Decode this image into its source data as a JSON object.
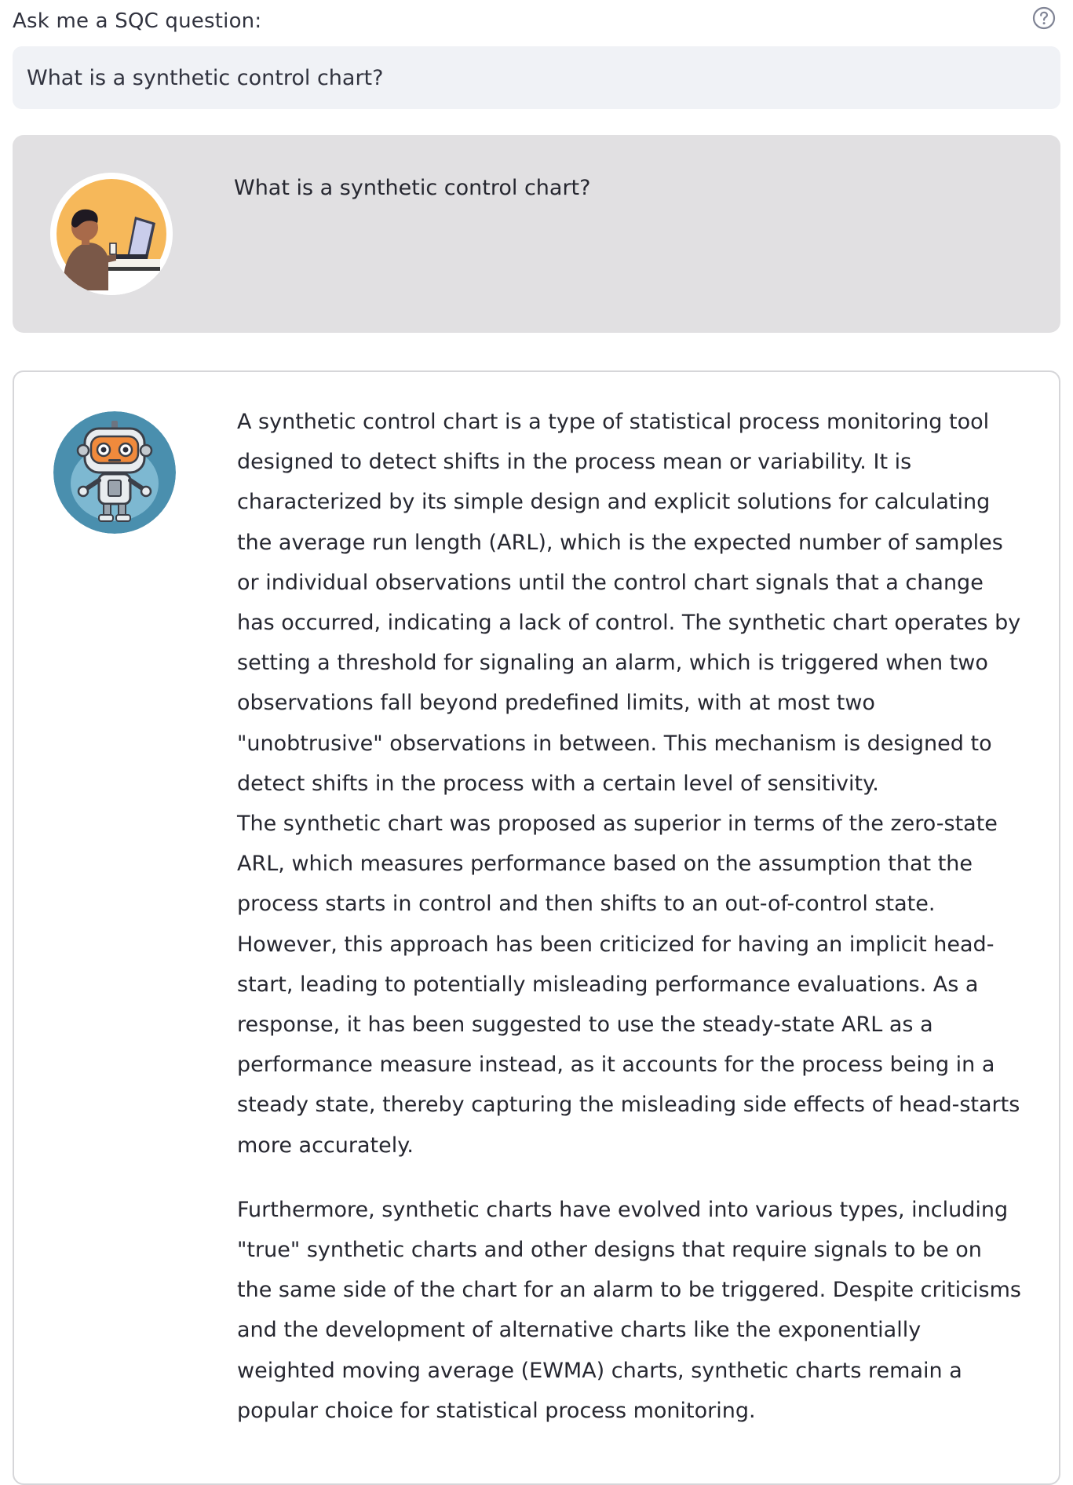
{
  "input": {
    "label": "Ask me a SQC question:",
    "value": "What is a synthetic control chart?",
    "help_icon": "help-circle-icon"
  },
  "user_message": {
    "avatar": "user-at-laptop-avatar",
    "text": "What is a synthetic control chart?"
  },
  "assistant_message": {
    "avatar": "robot-avatar",
    "paragraphs": [
      "A synthetic control chart is a type of statistical process monitoring tool designed to detect shifts in the process mean or variability. It is characterized by its simple design and explicit solutions for calculating the average run length (ARL), which is the expected number of samples or individual observations until the control chart signals that a change has occurred, indicating a lack of control. The synthetic chart operates by setting a threshold for signaling an alarm, which is triggered when two observations fall beyond predefined limits, with at most two \"unobtrusive\" observations in between. This mechanism is designed to detect shifts in the process with a certain level of sensitivity.",
      "The synthetic chart was proposed as superior in terms of the zero-state ARL, which measures performance based on the assumption that the process starts in control and then shifts to an out-of-control state. However, this approach has been criticized for having an implicit head-start, leading to potentially misleading performance evaluations. As a response, it has been suggested to use the steady-state ARL as a performance measure instead, as it accounts for the process being in a steady state, thereby capturing the misleading side effects of head-starts more accurately.",
      "Furthermore, synthetic charts have evolved into various types, including \"true\" synthetic charts and other designs that require signals to be on the same side of the chart for an alarm to be triggered. Despite criticisms and the development of alternative charts like the exponentially weighted moving average (EWMA) charts, synthetic charts remain a popular choice for statistical process monitoring."
    ]
  }
}
